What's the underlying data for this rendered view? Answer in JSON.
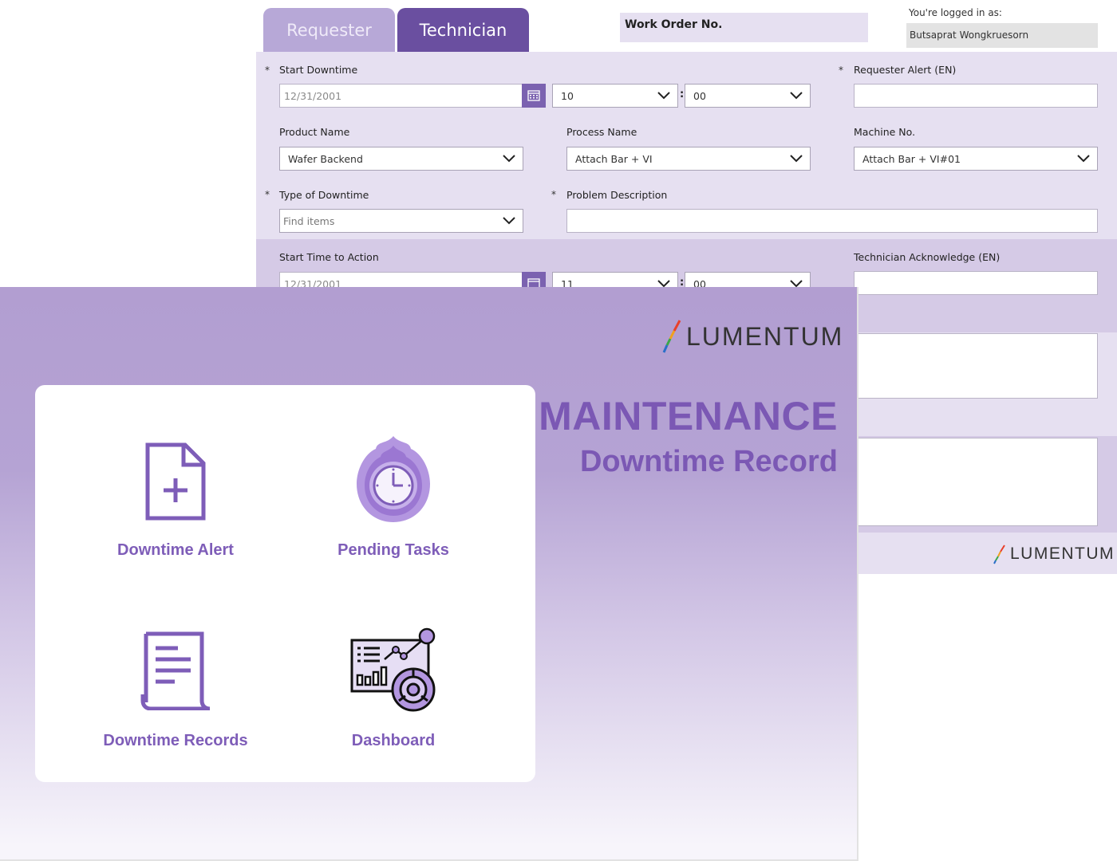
{
  "form": {
    "tabs": [
      {
        "label": "Requester"
      },
      {
        "label": "Technician"
      }
    ],
    "work_order_label": "Work Order No.",
    "logged_in_label": "You're logged in as:",
    "logged_in_user": "Butsaprat Wongkruesorn",
    "start_downtime": {
      "label": "Start Downtime",
      "date": "12/31/2001",
      "hour": "10",
      "minute": "00"
    },
    "requester_alert": {
      "label": "Requester Alert (EN)",
      "value": ""
    },
    "product_name": {
      "label": "Product Name",
      "value": "Wafer Backend"
    },
    "process_name": {
      "label": "Process Name",
      "value": "Attach Bar + VI"
    },
    "machine_no": {
      "label": "Machine No.",
      "value": "Attach Bar + VI#01"
    },
    "type_of_downtime": {
      "label": "Type of Downtime",
      "placeholder": "Find items"
    },
    "problem_description": {
      "label": "Problem Description",
      "value": ""
    },
    "start_time_to_action": {
      "label": "Start Time to Action",
      "date": "12/31/2001",
      "hour": "11",
      "minute": "00"
    },
    "technician_acknowledge": {
      "label": "Technician Acknowledge (EN)",
      "value": ""
    },
    "required_mark": "*",
    "time_separator": ":",
    "logo_text": "LUMENTUM"
  },
  "home": {
    "logo_text": "LUMENTUM",
    "title": "MAINTENANCE",
    "subtitle": "Downtime Record",
    "tiles": [
      {
        "label": "Downtime Alert",
        "icon": "new-document-icon"
      },
      {
        "label": "Pending Tasks",
        "icon": "clock-flame-icon"
      },
      {
        "label": "Downtime Records",
        "icon": "document-list-icon"
      },
      {
        "label": "Dashboard",
        "icon": "dashboard-chart-icon"
      }
    ]
  },
  "colors": {
    "primary": "#6a4fa0",
    "accent_text": "#7b58b4",
    "panel_light": "#e6e0f1",
    "panel_mid": "#d5cae6"
  }
}
